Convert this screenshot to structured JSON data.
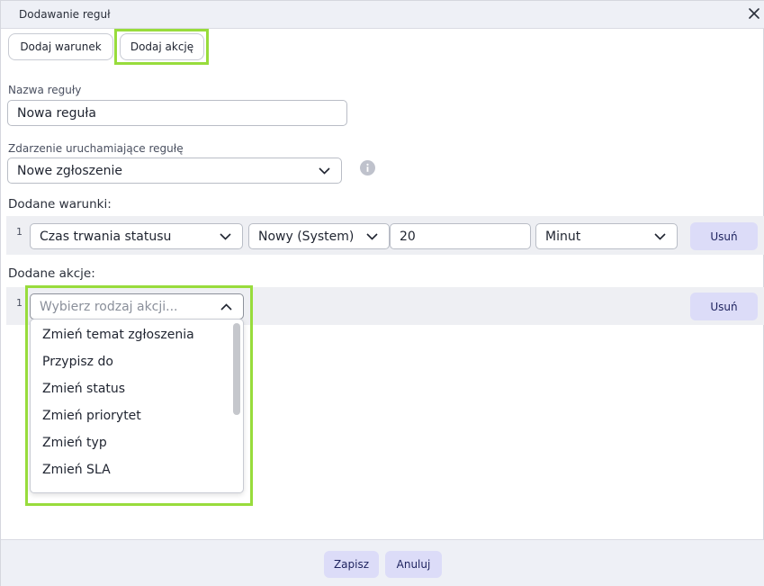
{
  "dialog": {
    "title": "Dodawanie reguł"
  },
  "toolbar": {
    "add_condition": "Dodaj warunek",
    "add_action": "Dodaj akcję"
  },
  "form": {
    "rule_name_label": "Nazwa reguły",
    "rule_name_value": "Nowa reguła",
    "trigger_label": "Zdarzenie uruchamiające regułę",
    "trigger_value": "Nowe zgłoszenie"
  },
  "conditions": {
    "label": "Dodane warunki:",
    "rows": [
      {
        "index": "1",
        "field": "Czas trwania statusu",
        "status": "Nowy (System)",
        "amount": "20",
        "unit": "Minut",
        "remove": "Usuń"
      }
    ]
  },
  "actions": {
    "label": "Dodane akcje:",
    "rows": [
      {
        "index": "1",
        "placeholder": "Wybierz rodzaj akcji...",
        "remove": "Usuń"
      }
    ],
    "options": [
      "Zmień temat zgłoszenia",
      "Przypisz do",
      "Zmień status",
      "Zmień priorytet",
      "Zmień typ",
      "Zmień SLA"
    ]
  },
  "footer": {
    "save": "Zapisz",
    "cancel": "Anuluj"
  },
  "colors": {
    "highlight": "#98dc3c",
    "button_bg": "#dcdcf8",
    "band_bg": "#eeeff3",
    "titlebar_bg": "#eef0f6"
  },
  "icons": {
    "close": "close-icon",
    "chevron": "chevron-down-icon",
    "chevron_up": "chevron-up-icon",
    "info": "info-icon"
  }
}
